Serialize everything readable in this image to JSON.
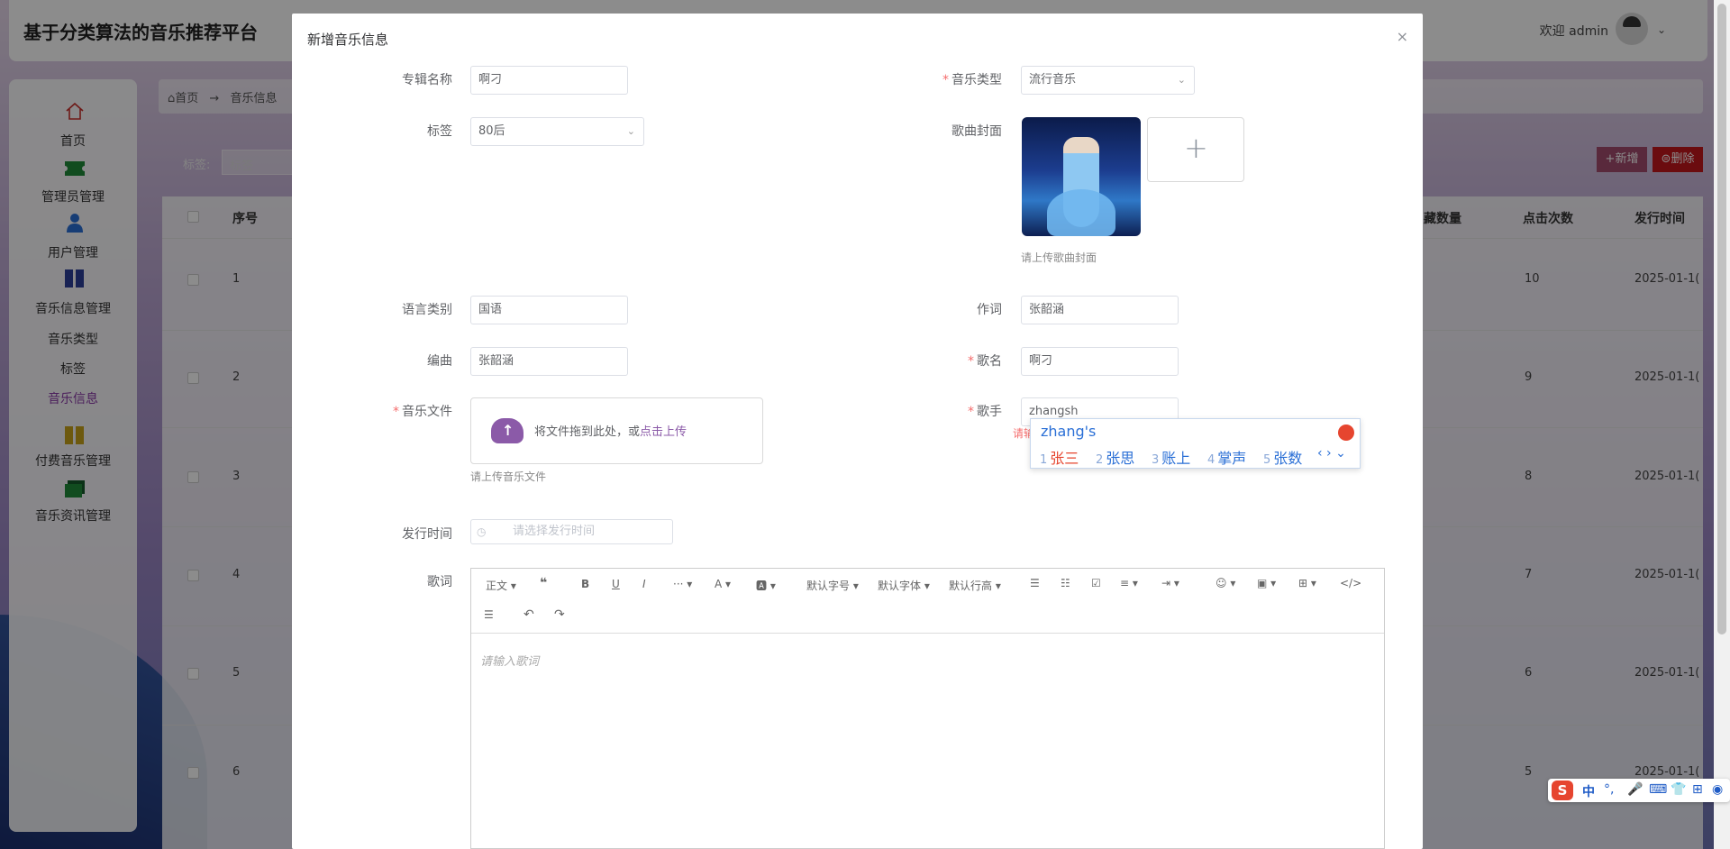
{
  "app": {
    "title": "基于分类算法的音乐推荐平台",
    "welcome": "欢迎 admin"
  },
  "sidebar": {
    "items": [
      {
        "label": "首页",
        "icon": "home-icon"
      },
      {
        "label": "管理员管理",
        "icon": "ticket-icon"
      },
      {
        "label": "用户管理",
        "icon": "user-icon"
      },
      {
        "label": "音乐信息管理",
        "icon": "book-icon"
      },
      {
        "label": "音乐类型"
      },
      {
        "label": "标签"
      },
      {
        "label": "音乐信息"
      },
      {
        "label": "付费音乐管理",
        "icon": "book-icon"
      },
      {
        "label": "音乐资讯管理",
        "icon": "folders-icon"
      }
    ]
  },
  "breadcrumb": {
    "home": "首页",
    "arrow": "→",
    "current": "音乐信息"
  },
  "filter": {
    "label": "标签:",
    "placeholder": "标签"
  },
  "actions": {
    "add": "+新增",
    "delete": "⊜删除"
  },
  "table": {
    "headers": {
      "index": "序号",
      "favorites": "藏数量",
      "clicks": "点击次数",
      "release": "发行时间"
    },
    "rows": [
      {
        "index": "1",
        "clicks": "10",
        "release": "2025-01-1("
      },
      {
        "index": "2",
        "clicks": "9",
        "release": "2025-01-1("
      },
      {
        "index": "3",
        "clicks": "8",
        "release": "2025-01-1("
      },
      {
        "index": "4",
        "clicks": "7",
        "release": "2025-01-1("
      },
      {
        "index": "5",
        "clicks": "6",
        "release": "2025-01-1("
      },
      {
        "index": "6",
        "clicks": "5",
        "release": "2025-01-1("
      }
    ]
  },
  "dialog": {
    "title": "新增音乐信息",
    "close": "×",
    "fields": {
      "album": {
        "label": "专辑名称",
        "value": "啊刁"
      },
      "music_type": {
        "label": "音乐类型",
        "value": "流行音乐"
      },
      "tag": {
        "label": "标签",
        "value": "80后"
      },
      "cover": {
        "label": "歌曲封面",
        "hint": "请上传歌曲封面",
        "add": "+"
      },
      "language": {
        "label": "语言类别",
        "value": "国语"
      },
      "lyricist": {
        "label": "作词",
        "value": "张韶涵"
      },
      "composer": {
        "label": "编曲",
        "value": "张韶涵"
      },
      "song_name": {
        "label": "歌名",
        "value": "啊刁"
      },
      "music_file": {
        "label": "音乐文件",
        "drop_text": "将文件拖到此处，或",
        "drop_link": "点击上传",
        "hint": "请上传音乐文件"
      },
      "singer": {
        "label": "歌手",
        "value": "zhangsh",
        "error": "请输"
      },
      "release_time": {
        "label": "发行时间",
        "placeholder": "请选择发行时间"
      },
      "lyrics": {
        "label": "歌词",
        "placeholder": "请输入歌词"
      }
    },
    "toolbar": {
      "paragraph": "正文",
      "font_size": "默认字号",
      "font_family": "默认字体",
      "line_height": "默认行高"
    }
  },
  "ime": {
    "composition": "zhang's",
    "candidates": [
      {
        "n": "1",
        "text": "张三"
      },
      {
        "n": "2",
        "text": "张思"
      },
      {
        "n": "3",
        "text": "账上"
      },
      {
        "n": "4",
        "text": "掌声"
      },
      {
        "n": "5",
        "text": "张数"
      }
    ]
  },
  "ime_bar": {
    "logo": "S",
    "lang": "中",
    "punct": "°,"
  }
}
